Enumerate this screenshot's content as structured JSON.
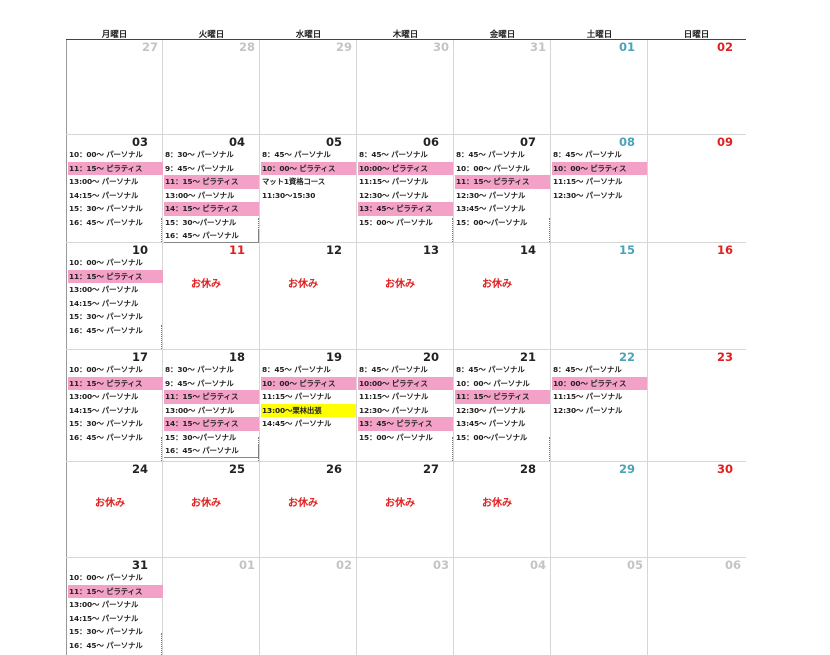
{
  "weekdays": [
    "月曜日",
    "火曜日",
    "水曜日",
    "木曜日",
    "金曜日",
    "土曜日",
    "日曜日"
  ],
  "closed_label": "お休み",
  "colors": {
    "pink": "#f3a1c6",
    "yellow": "#ffff00",
    "holiday": "#e02020",
    "saturday": "#4aa3b8",
    "muted": "#c4c4c4"
  },
  "weeks": [
    {
      "days": [
        {
          "num": "27",
          "kind": "grey",
          "events": []
        },
        {
          "num": "28",
          "kind": "grey",
          "events": []
        },
        {
          "num": "29",
          "kind": "grey",
          "events": []
        },
        {
          "num": "30",
          "kind": "grey",
          "events": []
        },
        {
          "num": "31",
          "kind": "grey",
          "events": []
        },
        {
          "num": "01",
          "kind": "sat",
          "events": []
        },
        {
          "num": "02",
          "kind": "sun",
          "events": []
        }
      ]
    },
    {
      "days": [
        {
          "num": "03",
          "kind": "normal",
          "events": [
            {
              "text": "10：00～ パーソナル"
            },
            {
              "text": "11：15～ ピラティス",
              "hl": "pink"
            },
            {
              "text": "13:00～ パーソナル"
            },
            {
              "text": "14:15～ パーソナル"
            },
            {
              "text": "15：30～ パーソナル"
            },
            {
              "text": "16：45～ パーソナル"
            }
          ]
        },
        {
          "num": "04",
          "kind": "normal",
          "events": [
            {
              "text": "8：30～ パーソナル"
            },
            {
              "text": "9：45～ パーソナル"
            },
            {
              "text": "11：15～ ピラティス",
              "hl": "pink"
            },
            {
              "text": "13:00～ パーソナル"
            },
            {
              "text": "14：15～ ピラティス",
              "hl": "pink"
            },
            {
              "text": "15：30～パーソナル"
            },
            {
              "text": "16：45～ パーソナル",
              "boxed": true
            }
          ]
        },
        {
          "num": "05",
          "kind": "normal",
          "events": [
            {
              "text": "8：45～ パーソナル"
            },
            {
              "text": "10：00～ ピラティス",
              "hl": "pink"
            },
            {
              "text": "マット1資格コース"
            },
            {
              "text": "11:30～15:30"
            }
          ]
        },
        {
          "num": "06",
          "kind": "normal",
          "events": [
            {
              "text": "8：45～ パーソナル"
            },
            {
              "text": "10:00～ ピラティス",
              "hl": "pink"
            },
            {
              "text": "11:15～ パーソナル"
            },
            {
              "text": "12:30～ パーソナル"
            },
            {
              "text": "13：45～ ピラティス",
              "hl": "pink"
            },
            {
              "text": "15：00～ パーソナル"
            }
          ]
        },
        {
          "num": "07",
          "kind": "normal",
          "events": [
            {
              "text": "8：45～ パーソナル"
            },
            {
              "text": "10：00～ パーソナル"
            },
            {
              "text": "11：15～ ピラティス",
              "hl": "pink"
            },
            {
              "text": "12:30～ パーソナル"
            },
            {
              "text": "13:45～ パーソナル"
            },
            {
              "text": "15：00～パーソナル"
            }
          ]
        },
        {
          "num": "08",
          "kind": "sat",
          "events": [
            {
              "text": "8：45～ パーソナル"
            },
            {
              "text": "10：00～ ピラティス",
              "hl": "pink"
            },
            {
              "text": "11:15～ パーソナル"
            },
            {
              "text": "12:30～ パーソナル"
            }
          ]
        },
        {
          "num": "09",
          "kind": "sun",
          "events": []
        }
      ]
    },
    {
      "days": [
        {
          "num": "10",
          "kind": "normal",
          "events": [
            {
              "text": "10：00～ パーソナル"
            },
            {
              "text": "11：15～ ピラティス",
              "hl": "pink"
            },
            {
              "text": "13:00～ パーソナル"
            },
            {
              "text": "14:15～ パーソナル"
            },
            {
              "text": "15：30～ パーソナル"
            },
            {
              "text": "16：45～ パーソナル"
            }
          ]
        },
        {
          "num": "11",
          "kind": "hol",
          "closed": true,
          "events": []
        },
        {
          "num": "12",
          "kind": "normal",
          "closed": true,
          "events": []
        },
        {
          "num": "13",
          "kind": "normal",
          "closed": true,
          "events": []
        },
        {
          "num": "14",
          "kind": "normal",
          "closed": true,
          "events": []
        },
        {
          "num": "15",
          "kind": "sat",
          "events": []
        },
        {
          "num": "16",
          "kind": "sun",
          "events": []
        }
      ]
    },
    {
      "days": [
        {
          "num": "17",
          "kind": "normal",
          "events": [
            {
              "text": "10：00～ パーソナル"
            },
            {
              "text": "11：15～ ピラティス",
              "hl": "pink"
            },
            {
              "text": "13:00～ パーソナル"
            },
            {
              "text": "14:15～ パーソナル"
            },
            {
              "text": "15：30～ パーソナル"
            },
            {
              "text": "16：45～ パーソナル"
            }
          ]
        },
        {
          "num": "18",
          "kind": "normal",
          "events": [
            {
              "text": "8：30～ パーソナル"
            },
            {
              "text": "9：45～ パーソナル"
            },
            {
              "text": "11：15～ ピラティス",
              "hl": "pink"
            },
            {
              "text": "13:00～ パーソナル"
            },
            {
              "text": "14：15～ ピラティス",
              "hl": "pink"
            },
            {
              "text": "15：30～パーソナル"
            },
            {
              "text": "16：45～ パーソナル",
              "boxed": true
            }
          ]
        },
        {
          "num": "19",
          "kind": "normal",
          "events": [
            {
              "text": "8：45～ パーソナル"
            },
            {
              "text": "10：00～ ピラティス",
              "hl": "pink"
            },
            {
              "text": "11:15～ パーソナル"
            },
            {
              "text": "13:00～栗林出張",
              "hl": "yellow"
            },
            {
              "text": "14:45～ パーソナル"
            }
          ]
        },
        {
          "num": "20",
          "kind": "normal",
          "events": [
            {
              "text": "8：45～ パーソナル"
            },
            {
              "text": "10:00～ ピラティス",
              "hl": "pink"
            },
            {
              "text": "11:15～ パーソナル"
            },
            {
              "text": "12:30～ パーソナル"
            },
            {
              "text": "13：45～ ピラティス",
              "hl": "pink"
            },
            {
              "text": "15：00～ パーソナル"
            }
          ]
        },
        {
          "num": "21",
          "kind": "normal",
          "events": [
            {
              "text": "8：45～ パーソナル"
            },
            {
              "text": "10：00～ パーソナル"
            },
            {
              "text": "11：15～ ピラティス",
              "hl": "pink"
            },
            {
              "text": "12:30～ パーソナル"
            },
            {
              "text": "13:45～ パーソナル"
            },
            {
              "text": "15：00～パーソナル"
            }
          ]
        },
        {
          "num": "22",
          "kind": "sat",
          "events": [
            {
              "text": "8：45～ パーソナル"
            },
            {
              "text": "10：00～ ピラティス",
              "hl": "pink"
            },
            {
              "text": "11:15～ パーソナル"
            },
            {
              "text": "12:30～ パーソナル"
            }
          ]
        },
        {
          "num": "23",
          "kind": "sun",
          "events": []
        }
      ]
    },
    {
      "days": [
        {
          "num": "24",
          "kind": "normal",
          "closed": true,
          "events": []
        },
        {
          "num": "25",
          "kind": "normal",
          "closed": true,
          "events": []
        },
        {
          "num": "26",
          "kind": "normal",
          "closed": true,
          "events": []
        },
        {
          "num": "27",
          "kind": "normal",
          "closed": true,
          "events": []
        },
        {
          "num": "28",
          "kind": "normal",
          "closed": true,
          "events": []
        },
        {
          "num": "29",
          "kind": "sat",
          "events": []
        },
        {
          "num": "30",
          "kind": "sun",
          "events": []
        }
      ]
    },
    {
      "days": [
        {
          "num": "31",
          "kind": "normal",
          "events": [
            {
              "text": "10：00～ パーソナル"
            },
            {
              "text": "11：15～ ピラティス",
              "hl": "pink"
            },
            {
              "text": "13:00～ パーソナル"
            },
            {
              "text": "14:15～ パーソナル"
            },
            {
              "text": "15：30～ パーソナル"
            },
            {
              "text": "16：45～ パーソナル"
            }
          ]
        },
        {
          "num": "01",
          "kind": "grey",
          "events": []
        },
        {
          "num": "02",
          "kind": "grey",
          "events": []
        },
        {
          "num": "03",
          "kind": "grey",
          "events": []
        },
        {
          "num": "04",
          "kind": "grey",
          "events": []
        },
        {
          "num": "05",
          "kind": "grey",
          "events": []
        },
        {
          "num": "06",
          "kind": "grey",
          "events": []
        }
      ]
    }
  ]
}
